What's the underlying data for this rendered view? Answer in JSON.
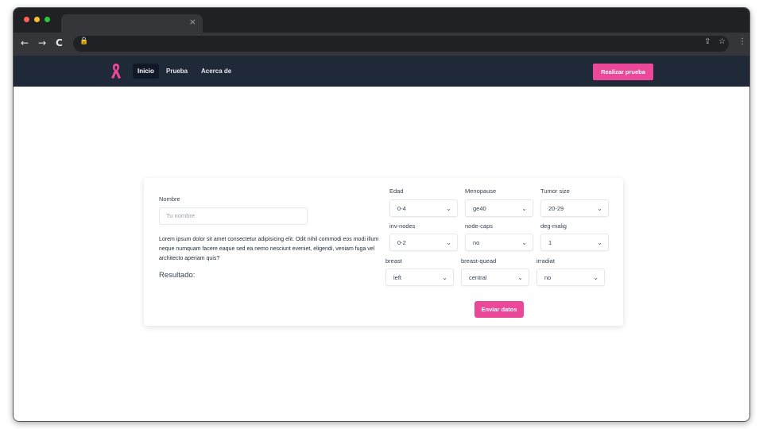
{
  "browser": {
    "tab_close": "×",
    "back": "←",
    "forward": "→",
    "reload": "C",
    "lock": "🔒",
    "share": "⇪",
    "bookmark": "☆",
    "menu": "⋮",
    "colors": {
      "close": "#ff5f57",
      "minimize": "#febc2e",
      "maximize": "#28c840"
    }
  },
  "navbar": {
    "logo_icon": "pink-ribbon-icon",
    "links": [
      "Inicio",
      "Prueba",
      "Acerca de"
    ],
    "active_link": "Inicio",
    "cta_label": "Realizar prueba"
  },
  "form": {
    "name_label": "Nombre",
    "name_placeholder": "Tu nombre",
    "description": "Lorem ipsum dolor sit amet consectetur adipisicing elit. Odit nihil commodi eos modi illum neque numquam facere eaque sed ea nemo nesciunt eveniet, eligendi, veniam fuga vel architecto aperiam quis?",
    "result_label": "Resultado:",
    "submit_label": "Enviar datos",
    "fields": [
      {
        "label": "Edad",
        "value": "0-4"
      },
      {
        "label": "Menopause",
        "value": "ge40"
      },
      {
        "label": "Tumor size",
        "value": "20-29"
      },
      {
        "label": "inv-nodes",
        "value": "0-2"
      },
      {
        "label": "node-caps",
        "value": "no"
      },
      {
        "label": "deg-malig",
        "value": "1"
      },
      {
        "label": "breast",
        "value": "left"
      },
      {
        "label": "breast-quead",
        "value": "central"
      },
      {
        "label": "irradiat",
        "value": "no"
      }
    ],
    "chevron": "⌄"
  },
  "colors": {
    "accent": "#ec4899",
    "navbar": "#1f2937"
  }
}
